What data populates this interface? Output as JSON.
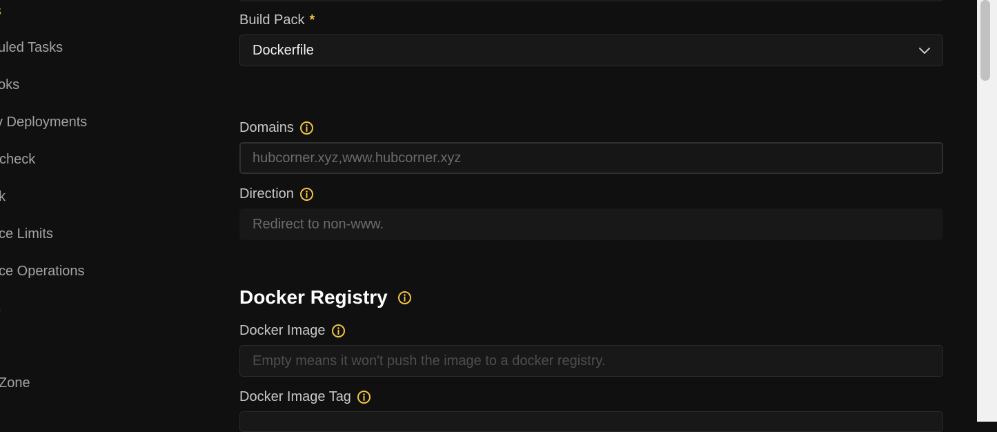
{
  "sidebar": {
    "items": [
      {
        "label": "s"
      },
      {
        "label": "uled Tasks"
      },
      {
        "label": "oks"
      },
      {
        "label": "v Deployments"
      },
      {
        "label": "check"
      },
      {
        "label": "k"
      },
      {
        "label": "ce Limits"
      },
      {
        "label": "ce Operations"
      },
      {
        "label": "s"
      },
      {
        "label": ""
      },
      {
        "label": " Zone"
      }
    ]
  },
  "form": {
    "build_pack": {
      "label": "Build Pack",
      "required_mark": "*",
      "value": "Dockerfile"
    },
    "domains": {
      "label": "Domains",
      "value": "hubcorner.xyz,www.hubcorner.xyz"
    },
    "direction": {
      "label": "Direction",
      "value": "Redirect to non-www."
    },
    "docker_registry": {
      "title": "Docker Registry"
    },
    "docker_image": {
      "label": "Docker Image",
      "placeholder": "Empty means it won't push the image to a docker registry."
    },
    "docker_image_tag": {
      "label": "Docker Image Tag"
    }
  },
  "colors": {
    "accent": "#f4c542",
    "background": "#101010"
  }
}
